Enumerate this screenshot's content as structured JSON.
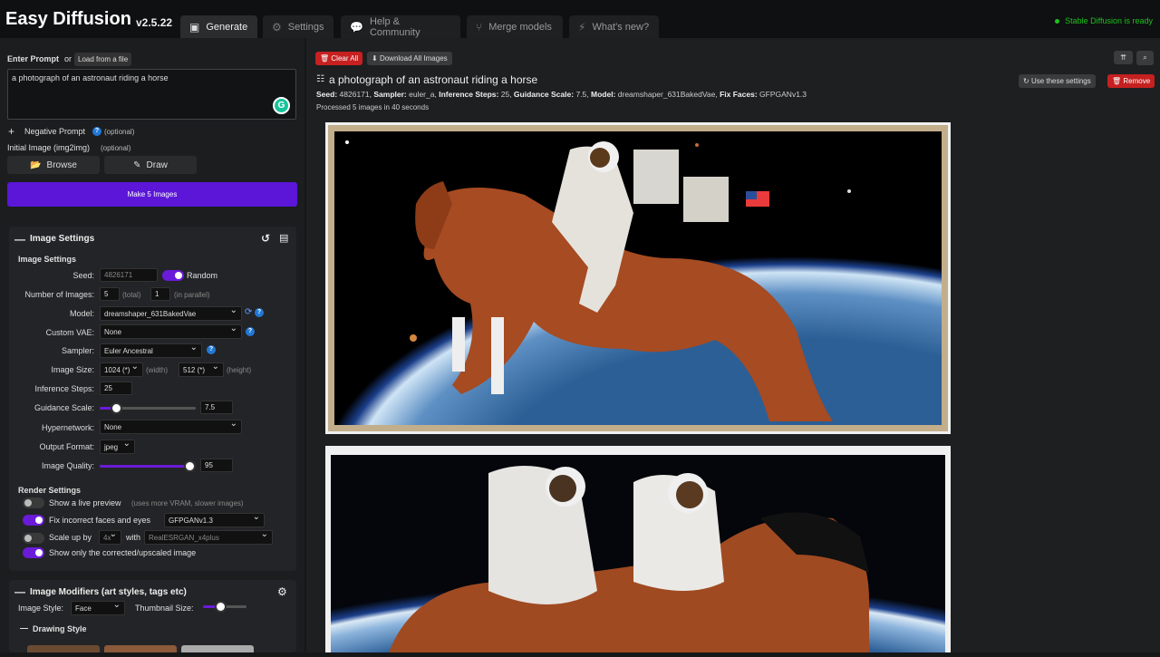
{
  "app": {
    "title": "Easy Diffusion",
    "version": "v2.5.22",
    "status": "Stable Diffusion is ready"
  },
  "tabs": [
    {
      "label": "Generate",
      "icon": "image-icon"
    },
    {
      "label": "Settings",
      "icon": "gear-icon"
    },
    {
      "label": "Help & Community",
      "icon": "chat-icon"
    },
    {
      "label": "Merge models",
      "icon": "merge-icon"
    },
    {
      "label": "What's new?",
      "icon": "bolt-icon"
    }
  ],
  "prompt": {
    "label": "Enter Prompt",
    "or": "or",
    "load_button": "Load from a file",
    "value": "a photograph of an astronaut riding a horse"
  },
  "negative": {
    "label": "Negative Prompt",
    "optional": "(optional)"
  },
  "init_image": {
    "label": "Initial Image (img2img)",
    "optional": "(optional)",
    "browse": "Browse",
    "draw": "Draw"
  },
  "make_button": "Make 5 Images",
  "image_settings": {
    "panel_title": "Image Settings",
    "section_title": "Image Settings",
    "seed_label": "Seed:",
    "seed_value": "4826171",
    "random_label": "Random",
    "num_images_label": "Number of Images:",
    "num_total": "5",
    "total_hint": "(total)",
    "num_parallel": "1",
    "parallel_hint": "(in parallel)",
    "model_label": "Model:",
    "model_value": "dreamshaper_631BakedVae",
    "vae_label": "Custom VAE:",
    "vae_value": "None",
    "sampler_label": "Sampler:",
    "sampler_value": "Euler Ancestral",
    "size_label": "Image Size:",
    "width_value": "1024 (*)",
    "width_hint": "(width)",
    "height_value": "512 (*)",
    "height_hint": "(height)",
    "steps_label": "Inference Steps:",
    "steps_value": "25",
    "guidance_label": "Guidance Scale:",
    "guidance_value": "7.5",
    "guidance_fraction": 0.18,
    "hypernetwork_label": "Hypernetwork:",
    "hypernetwork_value": "None",
    "format_label": "Output Format:",
    "format_value": "jpeg",
    "quality_label": "Image Quality:",
    "quality_value": "95",
    "quality_fraction": 0.95
  },
  "render_settings": {
    "title": "Render Settings",
    "preview_label": "Show a live preview",
    "preview_hint": "(uses more VRAM, slower images)",
    "fix_faces_label": "Fix incorrect faces and eyes",
    "fix_faces_value": "GFPGANv1.3",
    "upscale_label": "Scale up by",
    "upscale_factor": "4x",
    "upscale_with": "with",
    "upscale_model": "RealESRGAN_x4plus",
    "corrected_label": "Show only the corrected/upscaled image"
  },
  "modifiers": {
    "title": "Image Modifiers (art styles, tags etc)",
    "style_label": "Image Style:",
    "style_value": "Face",
    "thumb_label": "Thumbnail Size:",
    "drawing_style": "Drawing Style"
  },
  "toolbar": {
    "clear_all": "Clear All",
    "download_all": "Download All Images"
  },
  "task": {
    "title": "a photograph of an astronaut riding a horse",
    "seed_label": "Seed:",
    "seed": "4826171",
    "sampler_label": "Sampler:",
    "sampler": "euler_a",
    "steps_label": "Inference Steps:",
    "steps": "25",
    "guidance_label": "Guidance Scale:",
    "guidance": "7.5",
    "model_label": "Model:",
    "model": "dreamshaper_631BakedVae",
    "faces_label": "Fix Faces:",
    "faces": "GFPGANv1.3",
    "processed": "Processed 5 images in 40 seconds",
    "use_settings": "Use these settings",
    "remove": "Remove"
  },
  "colors": {
    "accent": "#5b16d8",
    "danger": "#c62020",
    "ready": "#1ec11e"
  }
}
